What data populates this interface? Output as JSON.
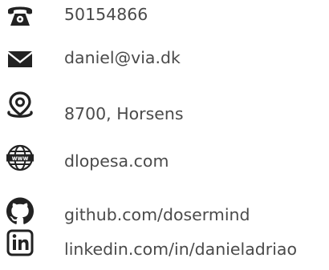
{
  "contact": {
    "phone": {
      "text": "50154866",
      "icon": "phone-icon"
    },
    "email": {
      "text": "daniel@via.dk",
      "icon": "envelope-icon"
    },
    "location": {
      "text": "8700, Horsens",
      "icon": "location-pin-icon"
    },
    "website": {
      "text": "dlopesa.com",
      "icon": "globe-www-icon"
    },
    "github": {
      "text": "github.com/dosermind",
      "icon": "github-icon"
    },
    "linkedin": {
      "text": "linkedin.com/in/danieladriao",
      "icon": "linkedin-icon"
    }
  },
  "colors": {
    "icon": "#222222",
    "text": "#4a4a4a",
    "background": "#ffffff"
  }
}
